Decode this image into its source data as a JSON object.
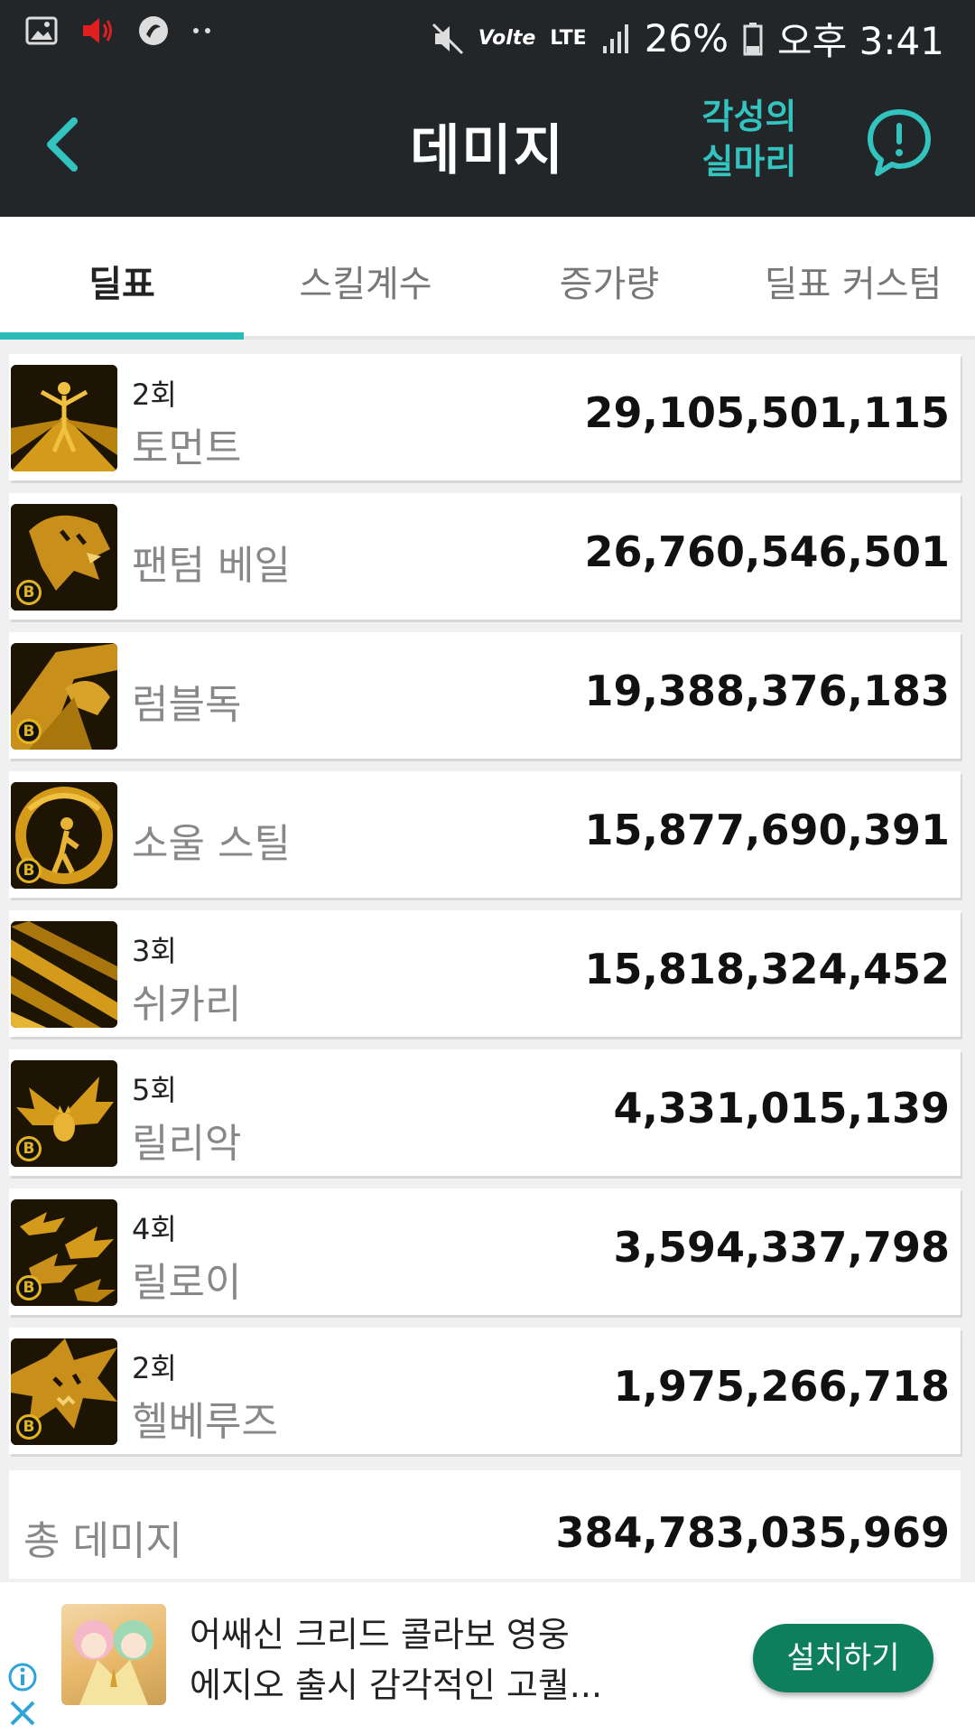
{
  "status_bar": {
    "network": "Volte",
    "lte": "LTE",
    "battery": "26%",
    "time": "오후 3:41",
    "icons": [
      "gallery-icon",
      "volume-icon",
      "app-icon",
      "more-dots-icon",
      "mute-icon",
      "signal-icon",
      "battery-icon"
    ]
  },
  "header": {
    "title": "데미지",
    "awaken_line1": "각성의",
    "awaken_line2": "실마리",
    "accent": "#33c4bf"
  },
  "tabs": [
    {
      "label": "딜표",
      "active": true
    },
    {
      "label": "스킬계수",
      "active": false
    },
    {
      "label": "증가량",
      "active": false
    },
    {
      "label": "딜표 커스텀",
      "active": false
    }
  ],
  "skills": [
    {
      "hits": "2회",
      "name": "토먼트",
      "damage": "29,105,501,115",
      "badge": false
    },
    {
      "hits": "",
      "name": "팬텀 베일",
      "damage": "26,760,546,501",
      "badge": true
    },
    {
      "hits": "",
      "name": "럼블독",
      "damage": "19,388,376,183",
      "badge": true
    },
    {
      "hits": "",
      "name": "소울 스틸",
      "damage": "15,877,690,391",
      "badge": true
    },
    {
      "hits": "3회",
      "name": "쉬카리",
      "damage": "15,818,324,452",
      "badge": false
    },
    {
      "hits": "5회",
      "name": "릴리악",
      "damage": "4,331,015,139",
      "badge": true
    },
    {
      "hits": "4회",
      "name": "릴로이",
      "damage": "3,594,337,798",
      "badge": true
    },
    {
      "hits": "2회",
      "name": "헬베루즈",
      "damage": "1,975,266,718",
      "badge": true
    }
  ],
  "badge_letter": "B",
  "total": {
    "label": "총 데미지",
    "value": "384,783,035,969"
  },
  "ad": {
    "line1": "어쌔신 크리드 콜라보 영웅",
    "line2": "에지오 출시 감각적인 고퀄...",
    "install_label": "설치하기",
    "button_color": "#0d7f5c"
  }
}
